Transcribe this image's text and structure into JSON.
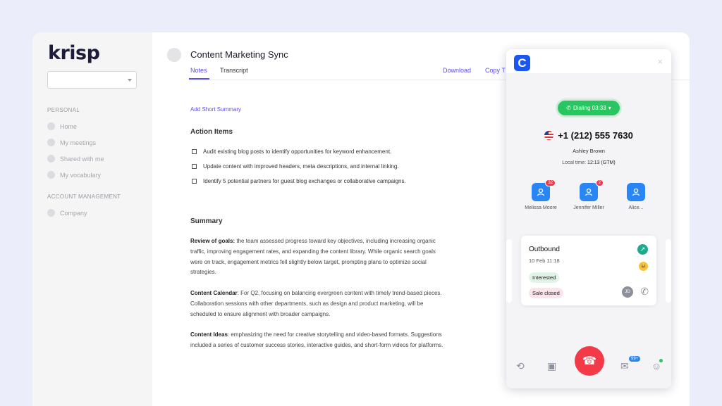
{
  "sidebar": {
    "logo": "krisp",
    "sections": [
      {
        "header": "PERSONAL",
        "items": [
          "Home",
          "My meetings",
          "Shared with me",
          "My vocabulary"
        ]
      },
      {
        "header": "ACCOUNT MANAGEMENT",
        "items": [
          "Company"
        ]
      }
    ]
  },
  "doc": {
    "title": "Content Marketing Sync",
    "tabs": [
      "Notes",
      "Transcript"
    ],
    "actions": [
      "Download",
      "Copy T"
    ],
    "add_summary": "Add Short Summary",
    "action_items_title": "Action Items",
    "action_items": [
      "Audit existing blog posts to identify opportunities for keyword enhancement.",
      "Update content with improved headers, meta descriptions, and internal linking.",
      "Identify 5 potential partners for guest blog exchanges or collaborative campaigns."
    ],
    "summary_title": "Summary",
    "summary": [
      {
        "label": "Review of goals:",
        "text": " the team assessed progress toward key objectives, including increasing organic traffic, improving engagement rates, and expanding the content library. While organic search goals were on track, engagement metrics fell slightly below target, prompting plans to optimize social strategies."
      },
      {
        "label": "Content Calendar",
        "text": ": For Q2, focusing on balancing evergreen content with timely trend-based pieces. Collaboration sessions with other departments, such as design and product marketing, will be scheduled to ensure alignment with broader campaigns."
      },
      {
        "label": "Content Ideas",
        "text": ": emphasizing the need for creative storytelling and video-based formats. Suggestions included a series of customer success stories, interactive guides, and short-form videos for platforms."
      }
    ]
  },
  "dialer": {
    "logo_letter": "C",
    "close_icon": "×",
    "status": "Dialing 03:33",
    "number": "+1 (212) 555 7630",
    "contact_name": "Ashley Brown",
    "local_time_label": "Local time: ",
    "local_time_value": "12:13 (GTM)",
    "people": [
      {
        "name": "Melissa Moore",
        "badge": "32"
      },
      {
        "name": "Jennifer Miller",
        "badge": "2"
      },
      {
        "name": "Alice...",
        "badge": ""
      }
    ],
    "card": {
      "title": "Outbound",
      "date": "10 Feb 11:18",
      "tags": [
        "Interested",
        "Sale closed"
      ],
      "initials": "JD"
    },
    "message_badge": "99+",
    "accent": "#1a56f0",
    "hangup_color": "#f23a48"
  }
}
